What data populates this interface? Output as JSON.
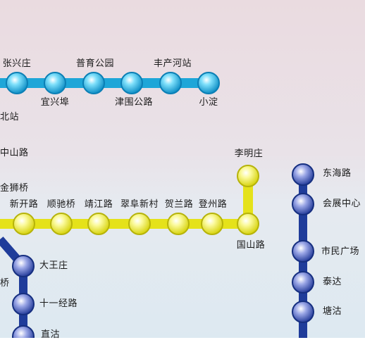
{
  "colors": {
    "line_cyan": "#1ea6d8",
    "line_yellow": "#e5e21a",
    "line_navy": "#1f3c9a",
    "station_fill_cyan": "#5fd0f0",
    "station_fill_yellow": "#f7f587",
    "station_fill_navy": "#7e8fdc"
  },
  "lines": {
    "cyan": {
      "stations": [
        "张兴庄",
        "宜兴埠",
        "普育公园",
        "津围公路",
        "丰产河站",
        "小淀"
      ]
    },
    "yellow": {
      "stations": [
        "新开路",
        "顺驰桥",
        "靖江路",
        "翠阜新村",
        "贺兰路",
        "登州路",
        "国山路",
        "李明庄"
      ]
    },
    "navy_left": {
      "stations": [
        "大王庄",
        "十一经路",
        "直沽"
      ]
    },
    "navy_right": {
      "stations": [
        "东海路",
        "会展中心",
        "市民广场",
        "泰达",
        "塘沽"
      ]
    }
  },
  "partial_labels": [
    "北站",
    "中山路",
    "金狮桥",
    "桥"
  ]
}
